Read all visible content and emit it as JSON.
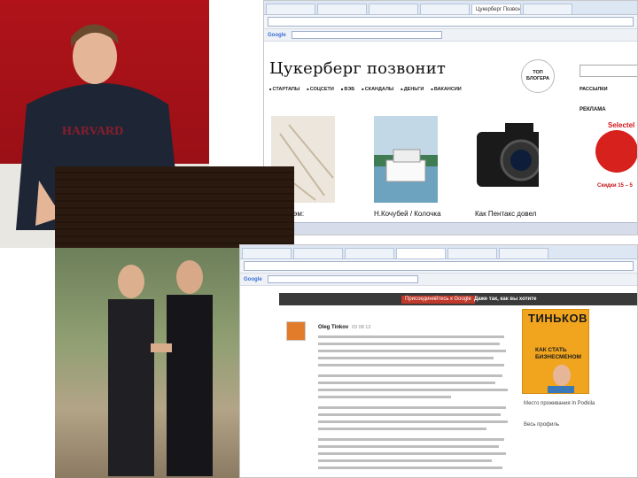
{
  "shot1": {
    "tabs": [
      "",
      "",
      "",
      "",
      "Цукерберг Позвонит",
      "",
      ""
    ],
    "search_engine_label": "Google",
    "blog": {
      "title": "Цукерберг позвонит",
      "nav": [
        "СТАРТАПЫ",
        "СОЦСЕТИ",
        "ВЭБ",
        "СКАНДАЛЫ",
        "ДЕНЬГИ",
        "ВАКАНСИИ"
      ],
      "badge": "ТОП\nБЛОГЕРА",
      "right_link": "РАССЫЛКИ",
      "ad_label": "РЕКЛАМА",
      "ad_brand": "Selectel",
      "ad_promo": "Скидки 15 – 5",
      "captions": [
        "Пол Грэм:",
        "Н.Кочубей / Колочка",
        "Как Пентакс довел"
      ]
    }
  },
  "shot2": {
    "search_engine_label": "Google",
    "promo_red": "Присоединяйтесь к Google",
    "promo_text": "Даже так, как вы хотите",
    "post": {
      "author": "Oleg Tinkov",
      "date": "03 08 12"
    },
    "book": {
      "title": "ТИНЬКОВ",
      "subtitle": "КАК СТАТЬ\nБИЗНЕСМЕНОМ"
    },
    "side": [
      "Место проживания ln Podkila",
      "Весь профиль"
    ]
  },
  "colors": {
    "wall_red": "#b0131a",
    "promo_bar": "#3a3a3a",
    "promo_red": "#c0392b",
    "book_orange": "#f1a51e",
    "ad_red": "#d7211d"
  },
  "icons": [
    "camera-icon",
    "browser-tab-icon"
  ]
}
